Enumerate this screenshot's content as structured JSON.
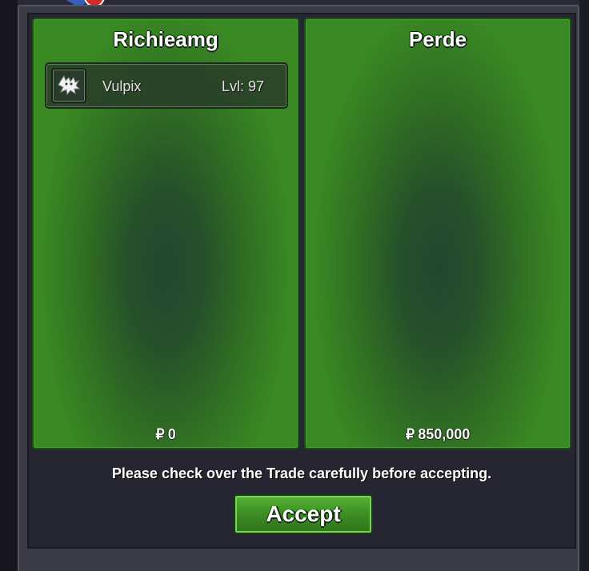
{
  "trade": {
    "left": {
      "player_name": "Richieamg",
      "items": [
        {
          "name": "Vulpix",
          "level": "Lvl: 97",
          "icon": "vulpix-sprite-icon"
        }
      ],
      "money_symbol": "₽",
      "money": "0"
    },
    "right": {
      "player_name": "Perde",
      "items": [],
      "money_symbol": "₽",
      "money": "850,000"
    },
    "notice": "Please check over the Trade carefully before accepting.",
    "accept_label": "Accept"
  },
  "colors": {
    "panel_green": "#3a8a23",
    "button_green": "#3b8a23",
    "background_dark": "#262633"
  }
}
